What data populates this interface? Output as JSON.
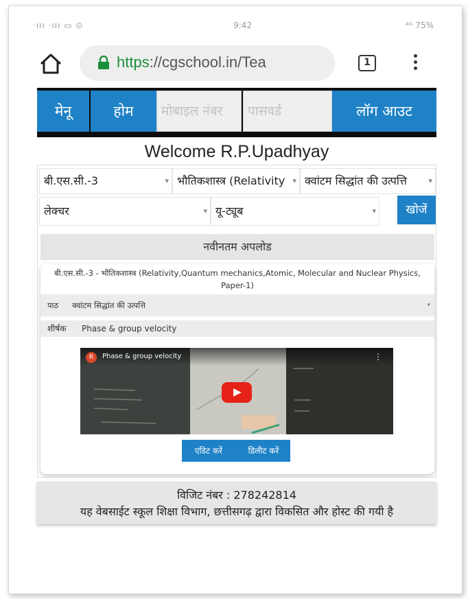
{
  "status_bar": {
    "left": "·ııı ·ııı ▭ ⊙",
    "center": "9:42",
    "right": "⁴ᴳ 75%"
  },
  "browser": {
    "url_scheme": "https",
    "url_rest": "://cgschool.in/Tea",
    "tab_count": "1",
    "icons": {
      "home": "home-icon",
      "lock": "lock-icon",
      "more": "more-vert-icon"
    },
    "colors": {
      "lock": "#1a8f3a"
    }
  },
  "nav": {
    "menu": "मेनू",
    "home": "होम",
    "mobile_placeholder": "मोबाइल नंबर",
    "password_placeholder": "पासवर्ड",
    "logout": "लॉग आउट",
    "accent": "#1f82c7"
  },
  "welcome": "Welcome R.P.Upadhyay",
  "filters": {
    "class_value": "बी.एस.सी.-3",
    "subject_value": "भौतिकशास्त्र (Relativity",
    "topic_value": "क्वांटम सिद्धांत की उत्पत्ति",
    "type_value": "लेक्चर",
    "source_value": "यू-ट्यूब",
    "search_label": "खोजें"
  },
  "latest": {
    "heading": "नवीनतम अपलोड",
    "course": "बी.एस.सी.-3 - भौतिकशास्त्र (Relativity,Quantum mechanics,Atomic, Molecular and Nuclear Physics, Paper-1)",
    "lesson_label": "पाठ",
    "lesson_value": "क्वांटम सिद्धांत की उत्पत्ति",
    "title_label": "शीर्षक",
    "title_value": "Phase & group velocity",
    "video": {
      "channel_initial": "R",
      "title": "Phase & group velocity",
      "play_icon": "youtube-play-icon"
    },
    "edit_label": "एडिट करें",
    "delete_label": "डिलीट करें"
  },
  "footer": {
    "visit_line": "विजिट नंबर : 278242814",
    "credit_line": "यह वेबसाईट स्कूल शिक्षा विभाग, छत्तीसगढ़ द्वारा विकसित और होस्ट की गयी है"
  }
}
